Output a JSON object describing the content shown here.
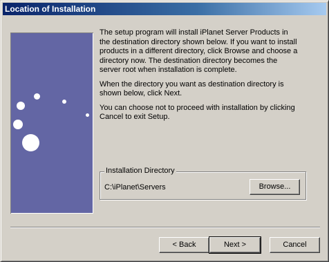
{
  "window": {
    "title": "Location of Installation"
  },
  "intro": {
    "paragraph1": "The setup program will install iPlanet Server Products in the destination directory shown below. If you want to install products in a different directory, click Browse and choose a directory now. The destination directory becomes the server root when installation is complete.",
    "paragraph2": "When the directory you want as destination directory is shown below, click Next.",
    "paragraph3": "You can choose not to proceed with installation by clicking Cancel to exit Setup."
  },
  "install_dir": {
    "group_label": "Installation Directory",
    "path": "C:\\iPlanet\\Servers",
    "browse_label": "Browse..."
  },
  "buttons": {
    "back_label": "< Back",
    "next_label": "Next >",
    "cancel_label": "Cancel"
  },
  "colors": {
    "panel": "#6366a4",
    "titlebar_start": "#0a246a",
    "titlebar_end": "#a6caf0",
    "dialog_face": "#d4d0c8"
  }
}
